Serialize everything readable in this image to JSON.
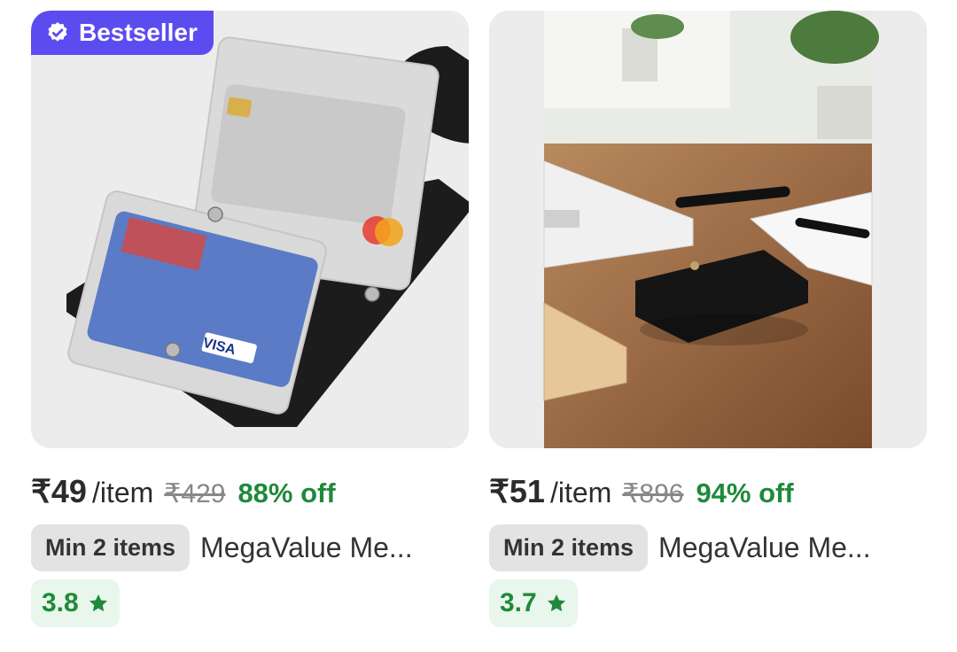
{
  "products": [
    {
      "badge": "Bestseller",
      "price": "₹49",
      "unit": " /item",
      "mrp": "₹429",
      "discount": "88% off",
      "min_items": "Min 2 items",
      "brand": "MegaValue Me...",
      "rating": "3.8"
    },
    {
      "price": "₹51",
      "unit": "/item",
      "mrp": "₹896",
      "discount": "94% off",
      "min_items": "Min 2 items",
      "brand": "MegaValue Me...",
      "rating": "3.7"
    }
  ],
  "colors": {
    "badge_bg": "#5b4cf0",
    "discount": "#1f8a3a",
    "rating_bg": "#e9f6ec"
  },
  "icons": [
    "verified-check-icon",
    "star-icon"
  ]
}
